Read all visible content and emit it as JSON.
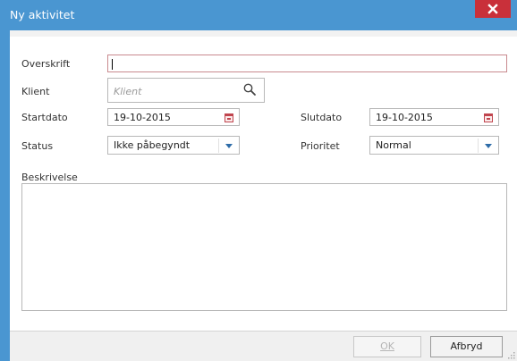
{
  "window": {
    "title": "Ny aktivitet",
    "close_icon": "close-icon",
    "accent_color": "#4a96d1",
    "close_color": "#c9303a"
  },
  "form": {
    "overskrift": {
      "label": "Overskrift",
      "value": ""
    },
    "klient": {
      "label": "Klient",
      "placeholder": "Klient",
      "icon": "search-icon"
    },
    "startdato": {
      "label": "Startdato",
      "value": "19-10-2015",
      "icon": "calendar-icon"
    },
    "slutdato": {
      "label": "Slutdato",
      "value": "19-10-2015",
      "icon": "calendar-icon"
    },
    "status": {
      "label": "Status",
      "value": "Ikke påbegyndt",
      "icon": "chevron-down-icon"
    },
    "prioritet": {
      "label": "Prioritet",
      "value": "Normal",
      "icon": "chevron-down-icon"
    },
    "beskrivelse": {
      "label": "Beskrivelse",
      "value": ""
    }
  },
  "footer": {
    "ok_label": "OK",
    "ok_enabled": false,
    "cancel_label": "Afbryd"
  }
}
